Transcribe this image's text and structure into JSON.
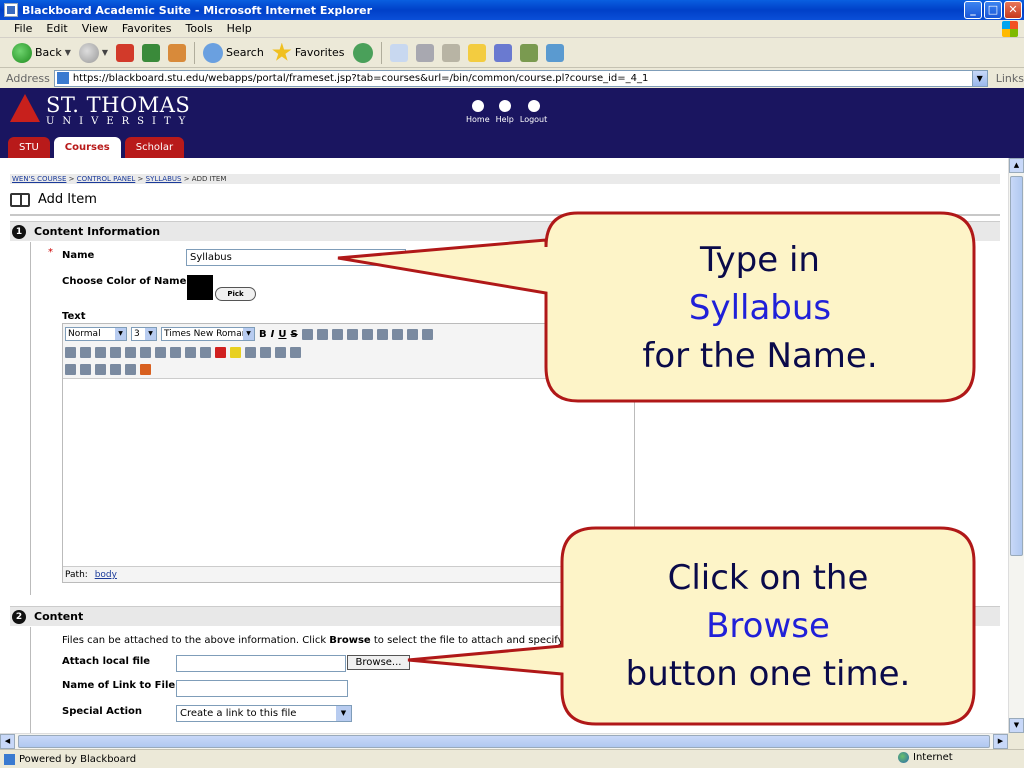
{
  "window": {
    "title": "Blackboard Academic Suite - Microsoft Internet Explorer",
    "controls": [
      "_",
      "□",
      "✕"
    ]
  },
  "menu": [
    "File",
    "Edit",
    "View",
    "Favorites",
    "Tools",
    "Help"
  ],
  "toolbar": {
    "back": "Back",
    "search": "Search",
    "favorites": "Favorites"
  },
  "address": {
    "label": "Address",
    "url": "https://blackboard.stu.edu/webapps/portal/frameset.jsp?tab=courses&url=/bin/common/course.pl?course_id=_4_1",
    "links": "Links"
  },
  "header": {
    "logo_line1": "ST. THOMAS",
    "logo_line2": "UNIVERSITY",
    "top_links": [
      "Home",
      "Help",
      "Logout"
    ],
    "tabs": [
      "STU",
      "Courses",
      "Scholar"
    ],
    "active_tab": "Courses"
  },
  "breadcrumb": [
    "WEN'S COURSE",
    "CONTROL PANEL",
    "SYLLABUS",
    "ADD ITEM"
  ],
  "page_title": "Add Item",
  "section1": {
    "number": "1",
    "title": "Content Information",
    "name_label": "Name",
    "required_marker": "*",
    "name_value": "Syllabus",
    "color_label": "Choose Color of Name",
    "pick_label": "Pick",
    "text_label": "Text",
    "editor": {
      "format": "Normal",
      "size": "3",
      "font": "Times New Roman",
      "path_label": "Path:",
      "path_value": "body"
    }
  },
  "section2": {
    "number": "2",
    "title": "Content",
    "description_start": "Files can be attached to the above information. Click ",
    "description_bold": "Browse",
    "description_end": " to select the file to attach and specify a name",
    "attach_label": "Attach local file",
    "browse_label": "Browse...",
    "link_name_label": "Name of Link to File",
    "special_action_label": "Special Action",
    "special_action_value": "Create a link to this file"
  },
  "status": {
    "text": "Powered by Blackboard",
    "zone": "Internet"
  },
  "callout1": {
    "line1": "Type in",
    "keyword": "Syllabus",
    "line3": "for the Name."
  },
  "callout2": {
    "line1": "Click on the",
    "keyword": "Browse",
    "line3": "button one time."
  },
  "colors": {
    "header_bg": "#1a1560",
    "tab_red": "#b81a1a",
    "callout_fill": "#fdf4c8",
    "callout_border": "#b01818",
    "keyword_blue": "#2020d8"
  }
}
